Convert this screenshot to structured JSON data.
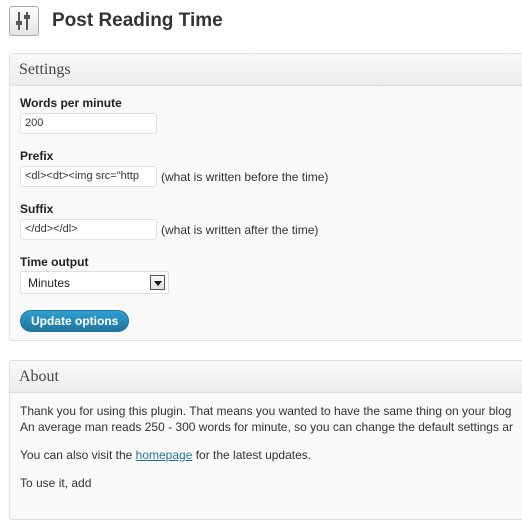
{
  "header": {
    "title": "Post Reading Time",
    "icon": "plugin-settings-icon"
  },
  "settings": {
    "title": "Settings",
    "words_per_minute": {
      "label": "Words per minute",
      "value": "200"
    },
    "prefix": {
      "label": "Prefix",
      "value": "<dl><dt><img src=\"http",
      "hint": "(what is written before the time)"
    },
    "suffix": {
      "label": "Suffix",
      "value": "</dd></dl>",
      "hint": "(what is written after the time)"
    },
    "time_output": {
      "label": "Time output",
      "selected": "Minutes"
    },
    "update_button": "Update options"
  },
  "about": {
    "title": "About",
    "line1": "Thank you for using this plugin. That means you wanted to have the same thing on your blog",
    "line2": "An average man reads 250 - 300 words for minute, so you can change the default settings ar",
    "visit_before": "You can also visit the ",
    "homepage_link": "homepage",
    "visit_after": " for the latest updates.",
    "to_use": "To use it, add"
  },
  "colors": {
    "primary_button": "#21759b",
    "link": "#21759b"
  }
}
